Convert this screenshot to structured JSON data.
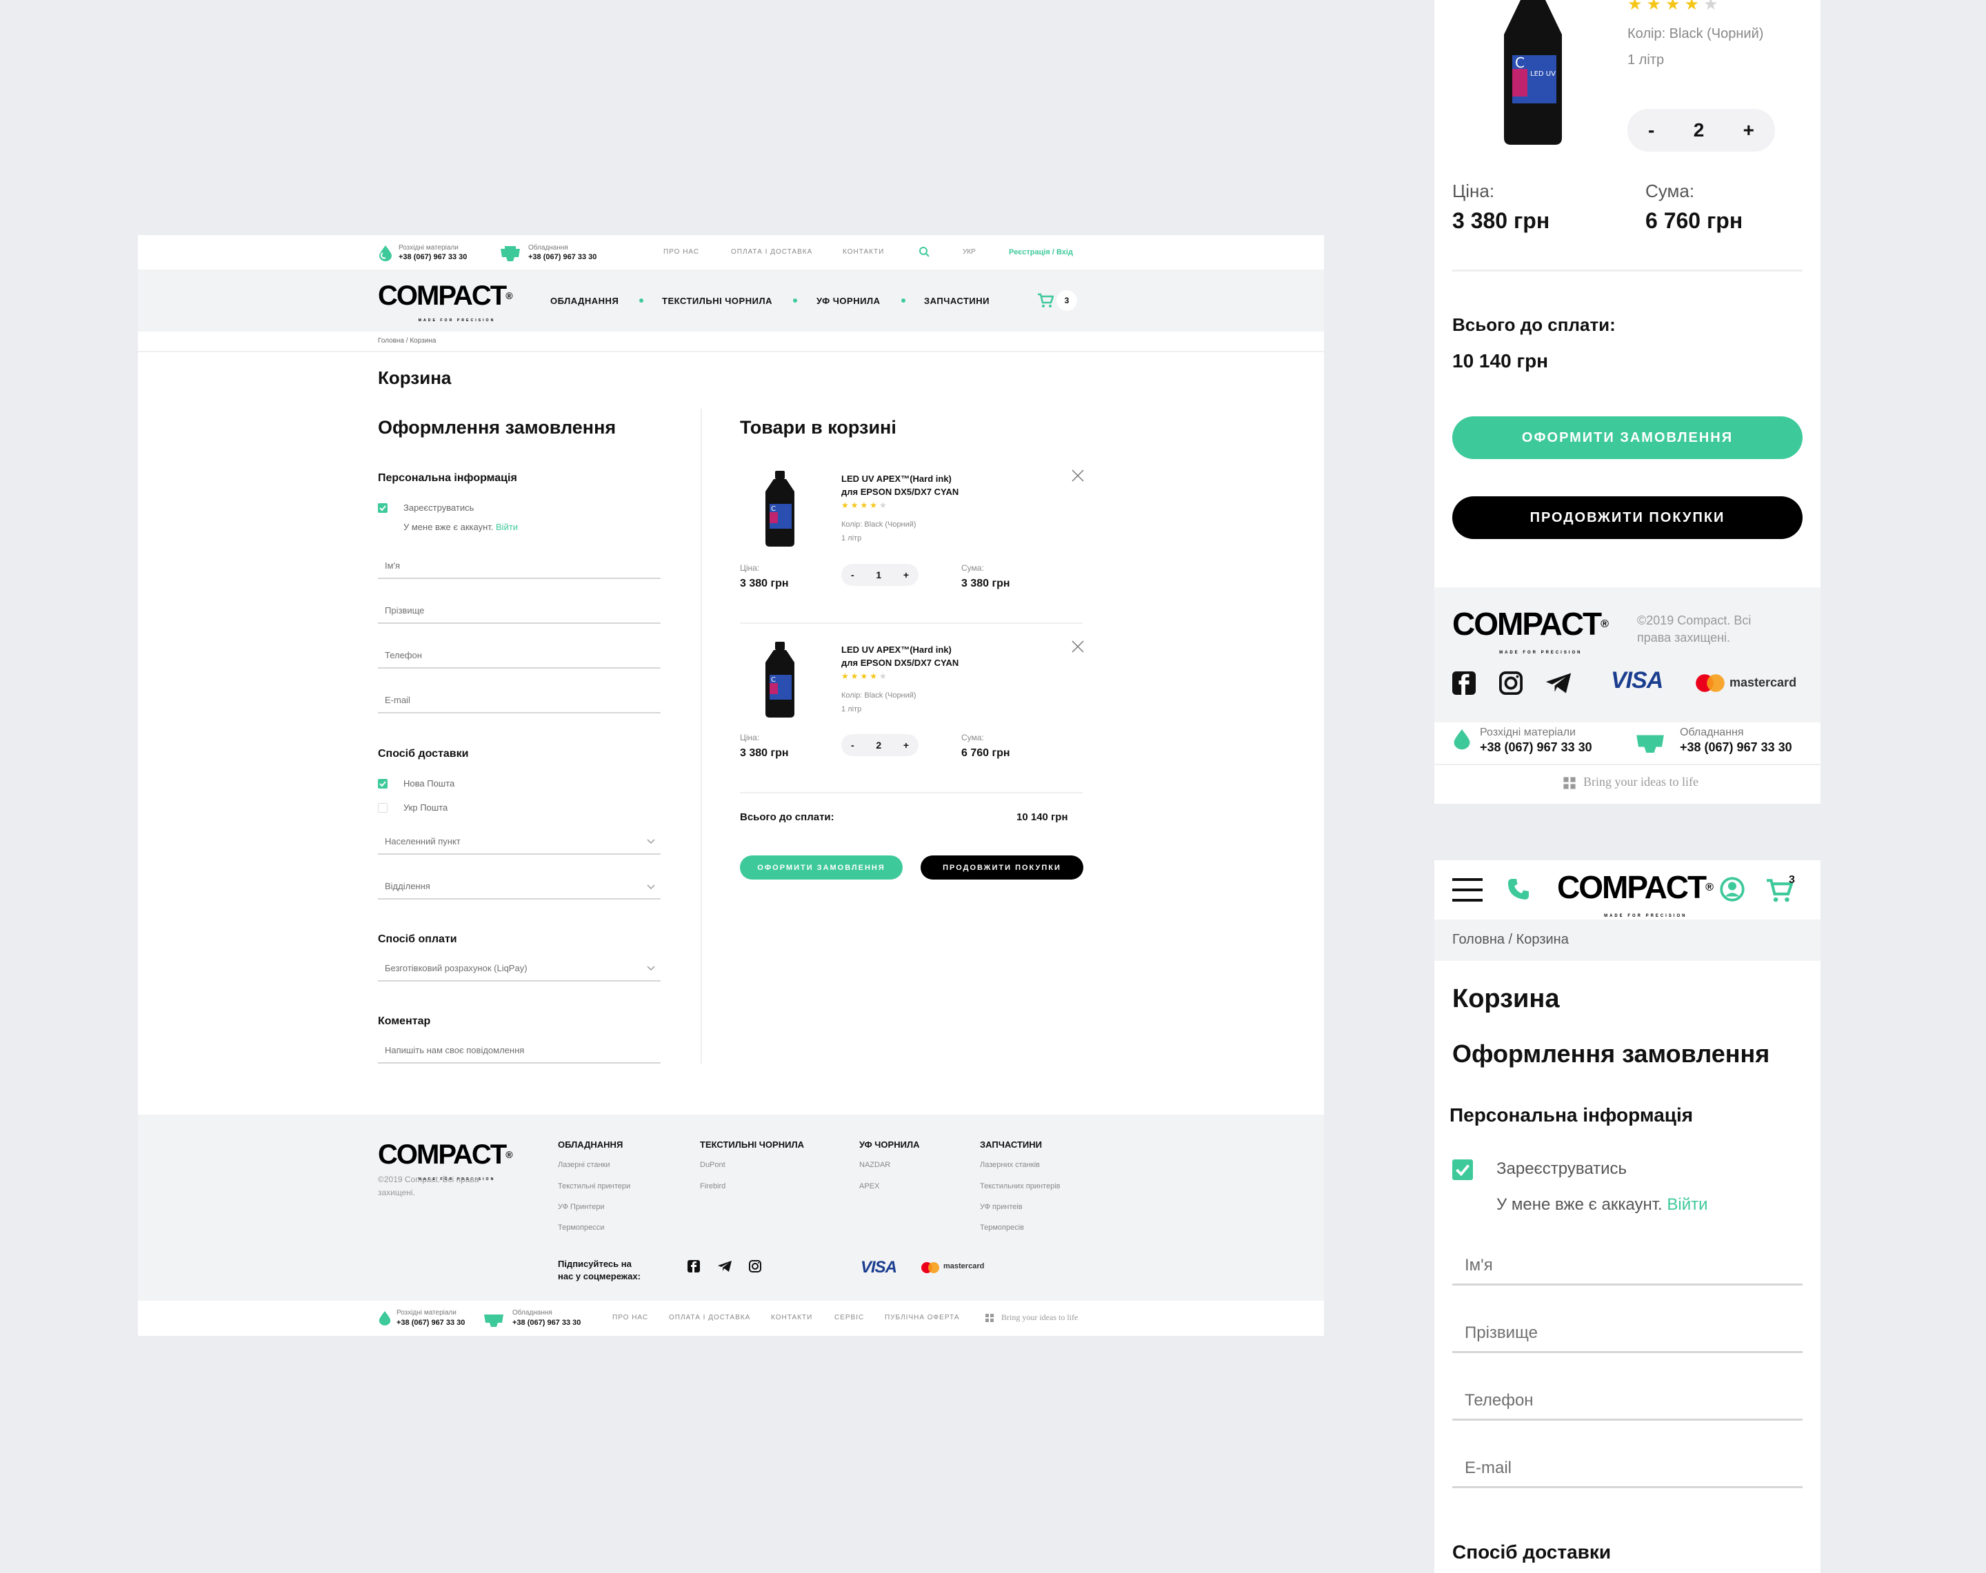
{
  "top_bar": {
    "consumables_label": "Розхідні матеріали",
    "consumables_phone": "+38 (067) 967 33 30",
    "equipment_label": "Обладнання",
    "equipment_phone": "+38 (067) 967 33 30",
    "nav": [
      "ПРО НАС",
      "ОПЛАТА І ДОСТАВКА",
      "КОНТАКТИ"
    ],
    "lang": "УКР",
    "auth": "Реєстрація / Вхід"
  },
  "logo": {
    "text": "COMPACT",
    "reg": "®",
    "tagline": "MADE FOR PRECISION"
  },
  "main_nav": [
    "ОБЛАДНАННЯ",
    "ТЕКСТИЛЬНІ ЧОРНИЛА",
    "УФ ЧОРНИЛА",
    "ЗАПЧАСТИНИ"
  ],
  "cart_count": "3",
  "breadcrumb": "Головна / Корзина",
  "page_title": "Корзина",
  "checkout": {
    "title": "Оформлення замовлення",
    "personal_title": "Персональна інформація",
    "register_label": "Зареєструватись",
    "have_account": "У мене вже є аккаунт.",
    "login_link": "Війти",
    "fields": {
      "name": "Ім'я",
      "surname": "Прізвище",
      "phone": "Телефон",
      "email": "E-mail"
    },
    "delivery_title": "Спосіб доставки",
    "delivery_options": [
      "Нова Пошта",
      "Укр Пошта"
    ],
    "city_placeholder": "Населенний пункт",
    "branch_placeholder": "Відділення",
    "payment_title": "Спосіб оплати",
    "payment_value": "Безготівковий розрахунок (LiqPay)",
    "comment_title": "Коментар",
    "comment_placeholder": "Напишіть нам своє повідомлення"
  },
  "cart": {
    "title": "Товари в корзині",
    "items": [
      {
        "name_line1": "LED UV APEX™(Hard ink)",
        "name_line2": "для EPSON DX5/DX7 CYAN",
        "rating": 4,
        "color": "Колір: Black (Чорний)",
        "volume": "1 літр",
        "price_label": "Ціна:",
        "price": "3 380 грн",
        "qty": "1",
        "sum_label": "Сума:",
        "sum": "3 380 грн"
      },
      {
        "name_line1": "LED UV APEX™(Hard ink)",
        "name_line2": "для EPSON DX5/DX7 CYAN",
        "rating": 4,
        "color": "Колір: Black (Чорний)",
        "volume": "1 літр",
        "price_label": "Ціна:",
        "price": "3 380 грн",
        "qty": "2",
        "sum_label": "Сума:",
        "sum": "6 760 грн"
      }
    ],
    "total_label": "Всього до сплати:",
    "total": "10 140 грн",
    "checkout_btn": "ОФОРМИТИ ЗАМОВЛЕННЯ",
    "continue_btn": "ПРОДОВЖИТИ ПОКУПКИ",
    "minus": "-",
    "plus": "+"
  },
  "footer": {
    "copyright": "©2019 Compact. Всі права захищені.",
    "columns": [
      {
        "title": "ОБЛАДНАННЯ",
        "links": [
          "Лазерні станки",
          "Текстильні принтери",
          "УФ Принтери",
          "Термопресси"
        ]
      },
      {
        "title": "ТЕКСТИЛЬНІ ЧОРНИЛА",
        "links": [
          "DuPont",
          "Firebird"
        ]
      },
      {
        "title": "УФ ЧОРНИЛА",
        "links": [
          "NAZDAR",
          "APEX"
        ]
      },
      {
        "title": "ЗАПЧАСТИНИ",
        "links": [
          "Лазерних станків",
          "Текстильних принтерів",
          "УФ принтеів",
          "Термопресів"
        ]
      }
    ],
    "social_label_1": "Підписуйтесь на",
    "social_label_2": "нас у соцмережах:",
    "visa": "VISA",
    "mastercard": "mastercard",
    "bottom_nav": [
      "ПРО НАС",
      "ОПЛАТА І ДОСТАВКА",
      "КОНТАКТИ",
      "СЕРВІС",
      "ПУБЛІЧНА ОФЕРТА"
    ],
    "slogan": "Bring your ideas to life"
  },
  "mobile_cart": {
    "color": "Колір: Black (Чорний)",
    "volume": "1 літр",
    "qty": "2",
    "price_label": "Ціна:",
    "price": "3 380 грн",
    "sum_label": "Сума:",
    "sum": "6 760 грн",
    "total_label": "Всього до сплати:",
    "total": "10 140 грн",
    "copyright_1": "©2019 Compact. Всі",
    "copyright_2": "права захищені."
  },
  "mobile_checkout": {
    "cart_count": "3",
    "breadcrumb": "Головна / Корзина",
    "page_title": "Корзина",
    "title": "Оформлення замовлення",
    "personal_title": "Персональна інформація",
    "register_label": "Зареєструватись",
    "have_account": "У мене вже є аккаунт.",
    "login_link": "Війти",
    "delivery_title": "Спосіб доставки"
  },
  "colors": {
    "accent": "#3ec99a",
    "star": "#f5c518",
    "black": "#000000",
    "bg": "#ecedf1"
  }
}
